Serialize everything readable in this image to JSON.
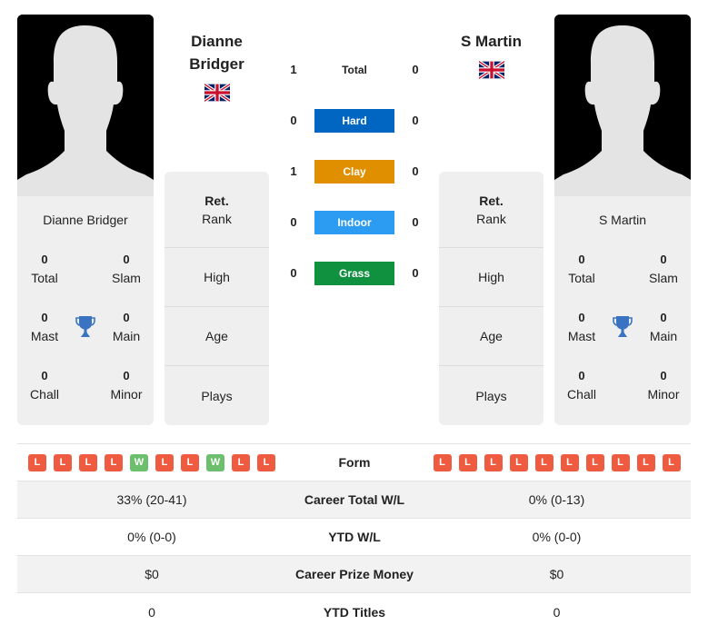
{
  "colors": {
    "hard": "#0066c2",
    "clay": "#e08f00",
    "indoor": "#2b9cf2",
    "grass": "#109140",
    "loss": "#ee5b40",
    "win": "#6cbf6c",
    "trophy": "#3a73c2"
  },
  "player1": {
    "name": "Dianne Bridger",
    "header_name": "Dianne Bridger",
    "flag": "uk-flag-icon",
    "card_name": "Dianne Bridger",
    "titles": {
      "total": {
        "value": "0",
        "label": "Total"
      },
      "slam": {
        "value": "0",
        "label": "Slam"
      },
      "mast": {
        "value": "0",
        "label": "Mast"
      },
      "main": {
        "value": "0",
        "label": "Main"
      },
      "chall": {
        "value": "0",
        "label": "Chall"
      },
      "minor": {
        "value": "0",
        "label": "Minor"
      }
    },
    "info": {
      "rank_top": "Ret.",
      "rank_label": "Rank",
      "high": "High",
      "age": "Age",
      "plays": "Plays"
    },
    "form": [
      "L",
      "L",
      "L",
      "L",
      "W",
      "L",
      "L",
      "W",
      "L",
      "L"
    ]
  },
  "player2": {
    "name": "S Martin",
    "header_name": "S Martin",
    "flag": "uk-flag-icon",
    "card_name": "S Martin",
    "titles": {
      "total": {
        "value": "0",
        "label": "Total"
      },
      "slam": {
        "value": "0",
        "label": "Slam"
      },
      "mast": {
        "value": "0",
        "label": "Mast"
      },
      "main": {
        "value": "0",
        "label": "Main"
      },
      "chall": {
        "value": "0",
        "label": "Chall"
      },
      "minor": {
        "value": "0",
        "label": "Minor"
      }
    },
    "info": {
      "rank_top": "Ret.",
      "rank_label": "Rank",
      "high": "High",
      "age": "Age",
      "plays": "Plays"
    },
    "form": [
      "L",
      "L",
      "L",
      "L",
      "L",
      "L",
      "L",
      "L",
      "L",
      "L"
    ]
  },
  "h2h": [
    {
      "label": "Total",
      "left": "1",
      "right": "0",
      "key": "total"
    },
    {
      "label": "Hard",
      "left": "0",
      "right": "0",
      "key": "hard"
    },
    {
      "label": "Clay",
      "left": "1",
      "right": "0",
      "key": "clay"
    },
    {
      "label": "Indoor",
      "left": "0",
      "right": "0",
      "key": "indoor"
    },
    {
      "label": "Grass",
      "left": "0",
      "right": "0",
      "key": "grass"
    }
  ],
  "table": {
    "form_label": "Form",
    "rows": [
      {
        "label": "Career Total W/L",
        "left": "33% (20-41)",
        "right": "0% (0-13)"
      },
      {
        "label": "YTD W/L",
        "left": "0% (0-0)",
        "right": "0% (0-0)"
      },
      {
        "label": "Career Prize Money",
        "left": "$0",
        "right": "$0"
      },
      {
        "label": "YTD Titles",
        "left": "0",
        "right": "0"
      }
    ]
  }
}
